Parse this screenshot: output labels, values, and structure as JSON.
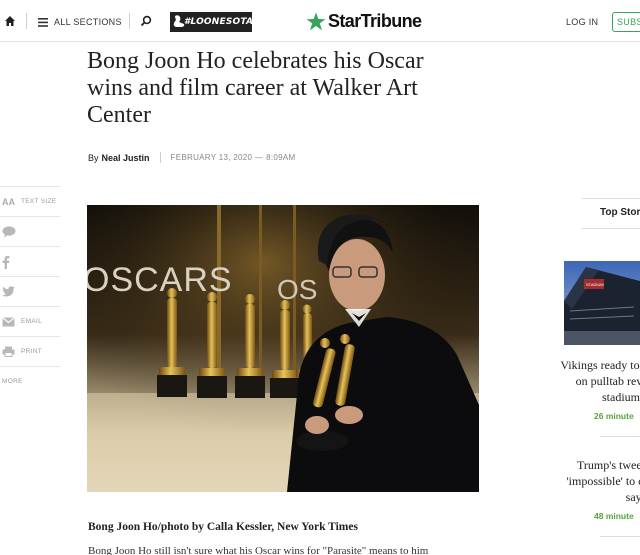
{
  "header": {
    "sections_label": "ALL SECTIONS",
    "promo_label": "#LOONESOTA",
    "brand": "StarTribune",
    "login_label": "LOG IN",
    "subscribe_label": "SUBS",
    "brand_color": "#3aa35b"
  },
  "article": {
    "headline": "Bong Joon Ho celebrates his Oscar wins and film career at Walker Art Center",
    "byline_prefix": "By",
    "author": "Neal Justin",
    "date": "FEBRUARY 13, 2020 —",
    "time": "8:09AM",
    "photo_backdrop_text": "OSCARS",
    "caption": "Bong Joon Ho/photo by Calla Kessler, New York Times",
    "body_first_line": "Bong Joon Ho still isn't sure what his Oscar wins for \"Parasite\" means to him"
  },
  "share_rail": {
    "text_size": "TEXT SIZE",
    "text_size_glyph": "AA",
    "email": "EMAIL",
    "print": "PRINT",
    "more": "MORE"
  },
  "top_stories": {
    "title": "Top Stor",
    "image_sign_text": "STADIUM",
    "items": [
      {
        "title_lines": [
          "Vikings ready to",
          "on pulltab rev",
          "stadium"
        ],
        "time": "26 minute"
      },
      {
        "title_lines": [
          "Trump's tweet",
          "'impossible' to c",
          "says"
        ],
        "time": "48 minute"
      }
    ]
  }
}
